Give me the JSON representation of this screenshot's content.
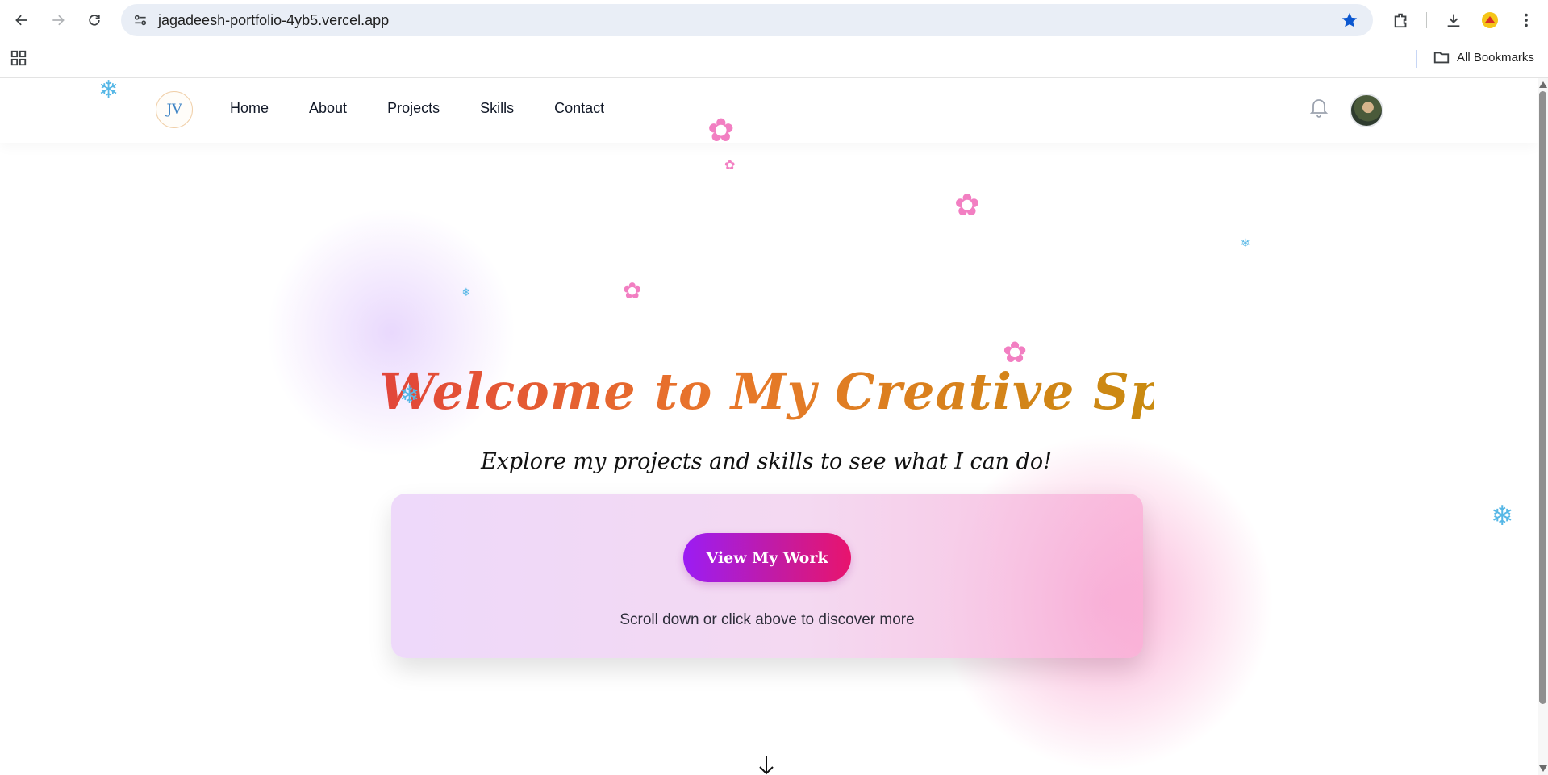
{
  "browser": {
    "url": "jagadeesh-portfolio-4yb5.vercel.app",
    "bookmarks_label": "All Bookmarks",
    "accent_color": "#0b57d0"
  },
  "header": {
    "logo_text": "JV",
    "menu": [
      "Home",
      "About",
      "Projects",
      "Skills",
      "Contact"
    ]
  },
  "hero": {
    "title": "Welcome to My Creative Space",
    "subtitle": "Explore my projects and skills to see what I can do!",
    "cta_label": "View My Work",
    "cta_hint": "Scroll down or click above to discover more"
  },
  "colors": {
    "title_gradient": [
      "#e2453a",
      "#e8782a",
      "#c98a10"
    ],
    "button_gradient": [
      "#9b1cf4",
      "#e8146d"
    ],
    "snowflake": "#56b7e6",
    "flower": "#f27fc2"
  },
  "icons": {
    "snowflake": "snowflake-icon",
    "flower": "flower-icon",
    "bell": "bell-icon",
    "down_arrow": "arrow-down-icon"
  },
  "decorations": {
    "snowflake_glyph": "❄",
    "flower_glyph": "✿"
  }
}
